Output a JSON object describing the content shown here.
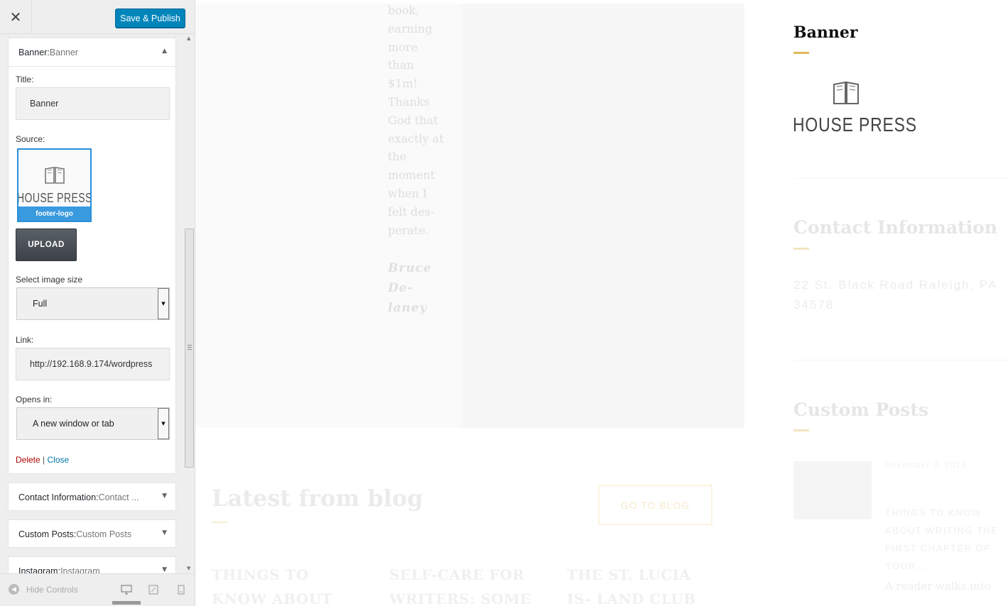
{
  "topbar": {
    "close_glyph": "✕",
    "publish_label": "Save & Publish"
  },
  "banner_widget": {
    "head_name": "Banner:",
    "head_title": " Banner",
    "arrow": "▲",
    "title_label": "Title:",
    "title_value": "Banner",
    "source_label": "Source:",
    "thumb_logo_text": "HOUSE PRESS",
    "thumb_caption": "footer-logo",
    "upload_label": "UPLOAD",
    "size_label": "Select image size",
    "size_value": "Full",
    "link_label": "Link:",
    "link_value": "http://192.168.9.174/wordpress",
    "opens_label": "Opens in:",
    "opens_value": "A new window or tab",
    "delete_label": "Delete",
    "separator": " | ",
    "close_label": "Close"
  },
  "collapsed_widgets": [
    {
      "name": "Contact Information:",
      "title": " Contact ...",
      "arrow": "▼"
    },
    {
      "name": "Custom Posts:",
      "title": " Custom Posts",
      "arrow": "▼"
    },
    {
      "name": "Instagram:",
      "title": " Instagram",
      "arrow": "▼"
    }
  ],
  "footer": {
    "hide_controls_label": "Hide Controls",
    "hide_icon_glyph": "◀",
    "devices": [
      "desktop-icon",
      "tablet-icon",
      "mobile-icon"
    ]
  },
  "preview": {
    "quote_text": "book, earning more than $1m! Thanks God that exactly at the moment when I felt des- perate.",
    "quote_author": "Bruce De- laney",
    "blog_heading": "Latest from blog",
    "go_blog_label": "GO TO BLOG",
    "posts": [
      "THINGS TO KNOW ABOUT WRITING",
      "SELF-CARE FOR WRITERS: SOME",
      "THE ST. LUCIA IS- LAND CLUB CHAP-"
    ],
    "right_widgets": {
      "banner_title": "Banner",
      "logo_text": "HOUSE PRESS",
      "contact_title": "Contact Information",
      "address": "22 St. Black Road Raleigh, PA 34578",
      "custom_posts_title": "Custom Posts",
      "post_date": "December 3, 2016",
      "post_title": "THINGS TO KNOW ABOUT WRITING THE FIRST CHAPTER OF YOUR...",
      "post_excerpt": "A reader walks into"
    }
  },
  "colors": {
    "publish_blue": "#0085ba",
    "accent_gold": "#e0b75a",
    "delete_red": "#aa0000",
    "link_blue": "#0073aa"
  }
}
